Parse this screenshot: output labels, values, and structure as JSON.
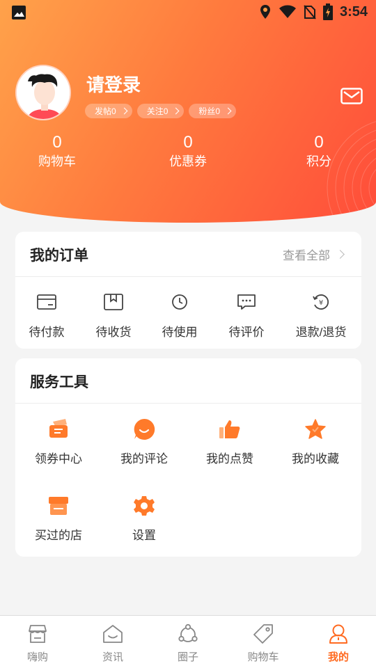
{
  "status_bar": {
    "time": "3:54"
  },
  "profile": {
    "login_label": "请登录",
    "chips": [
      {
        "label": "发帖0"
      },
      {
        "label": "关注0"
      },
      {
        "label": "粉丝0"
      }
    ]
  },
  "stats": [
    {
      "value": "0",
      "label": "购物车"
    },
    {
      "value": "0",
      "label": "优惠券"
    },
    {
      "value": "0",
      "label": "积分"
    }
  ],
  "orders": {
    "title": "我的订单",
    "view_all": "查看全部",
    "items": [
      {
        "label": "待付款",
        "icon": "card-icon"
      },
      {
        "label": "待收货",
        "icon": "package-icon"
      },
      {
        "label": "待使用",
        "icon": "clock-icon"
      },
      {
        "label": "待评价",
        "icon": "comment-icon"
      },
      {
        "label": "退款/退货",
        "icon": "refund-icon"
      }
    ]
  },
  "tools": {
    "title": "服务工具",
    "items": [
      {
        "label": "领券中心",
        "icon": "coupon-icon"
      },
      {
        "label": "我的评论",
        "icon": "smile-comment-icon"
      },
      {
        "label": "我的点赞",
        "icon": "thumbs-up-icon"
      },
      {
        "label": "我的收藏",
        "icon": "star-icon"
      },
      {
        "label": "买过的店",
        "icon": "store-icon"
      },
      {
        "label": "设置",
        "icon": "gear-icon"
      }
    ]
  },
  "bottom_nav": {
    "active_index": 4,
    "items": [
      {
        "label": "嗨购",
        "icon": "shop-icon"
      },
      {
        "label": "资讯",
        "icon": "news-icon"
      },
      {
        "label": "圈子",
        "icon": "circle-icon"
      },
      {
        "label": "购物车",
        "icon": "tag-icon"
      },
      {
        "label": "我的",
        "icon": "user-icon"
      }
    ]
  },
  "colors": {
    "accent": "#ff6a20",
    "header_start": "#ffa24a",
    "header_end": "#ff4d3a",
    "icon_orange": "#ff7a2a"
  }
}
